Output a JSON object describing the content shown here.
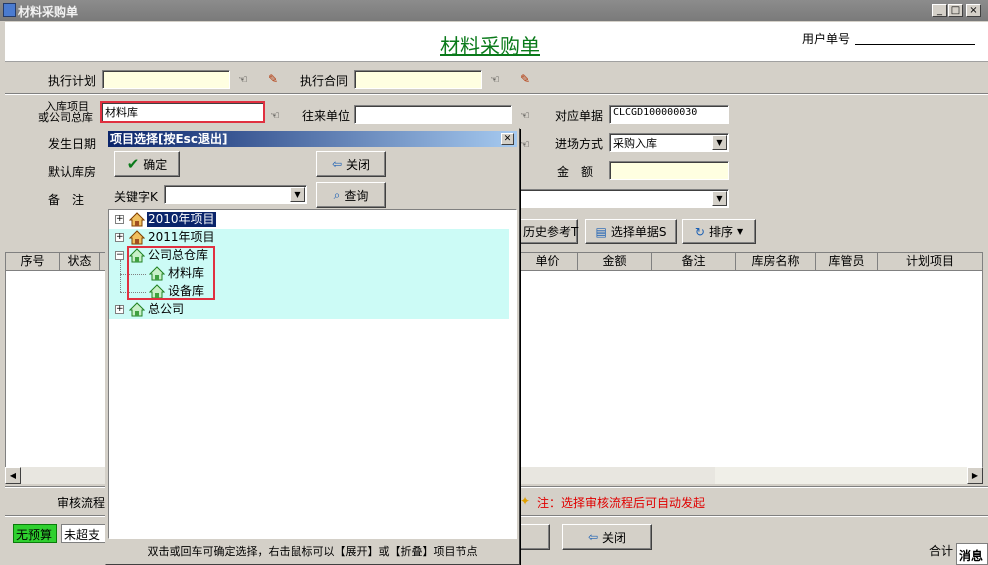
{
  "window": {
    "title": "材料采购单",
    "min": "_",
    "max": "□",
    "close": "×"
  },
  "header": {
    "doc_title": "材料采购单",
    "user_no_label": "用户单号"
  },
  "form": {
    "plan_label": "执行计划",
    "contract_label": "执行合同",
    "warehouse_label_1": "入库项目",
    "warehouse_label_2": "或公司总库",
    "warehouse_value": "材料库",
    "partner_label": "往来单位",
    "ref_doc_label": "对应单据",
    "ref_doc_value": "CLCGD100000030",
    "date_label": "发生日期",
    "entry_mode_label": "进场方式",
    "entry_mode_value": "采购入库",
    "default_store_label": "默认库房",
    "amount_label": "金　额",
    "remark_label": "备　注",
    "history_button": "历史参考T",
    "select_doc_button": "选择单据S",
    "sort_button": "排序"
  },
  "grid": {
    "columns": [
      "序号",
      "状态",
      "单价",
      "金额",
      "备注",
      "库房名称",
      "库管员",
      "计划项目"
    ]
  },
  "footer": {
    "audit_label": "审核流程",
    "audit_note": "注：选择审核流程后可自动发起",
    "close_button": "关闭",
    "badge_a": "无预算",
    "badge_b": "未超支",
    "total_label": "合计",
    "message_label": "消息"
  },
  "popup": {
    "title": "项目选择[按Esc退出]",
    "ok_button": "确定",
    "close_button": "关闭",
    "keyword_label": "关键字K",
    "query_button": "查询",
    "tree": [
      {
        "label": "2010年项目",
        "expander": "+",
        "selected": true
      },
      {
        "label": "2011年项目",
        "expander": "+"
      },
      {
        "label": "公司总仓库",
        "expander": "−"
      },
      {
        "label": "材料库"
      },
      {
        "label": "设备库"
      },
      {
        "label": "总公司",
        "expander": "+"
      }
    ],
    "hint": "双击或回车可确定选择，右击鼠标可以【展开】或【折叠】项目节点"
  },
  "colors": {
    "title_green": "#0a7a1a",
    "input_yellow": "#ffffe1",
    "highlight_cyan": "#ccfbf6",
    "red_note": "#e00000",
    "budget_green": "#2fd02f"
  }
}
